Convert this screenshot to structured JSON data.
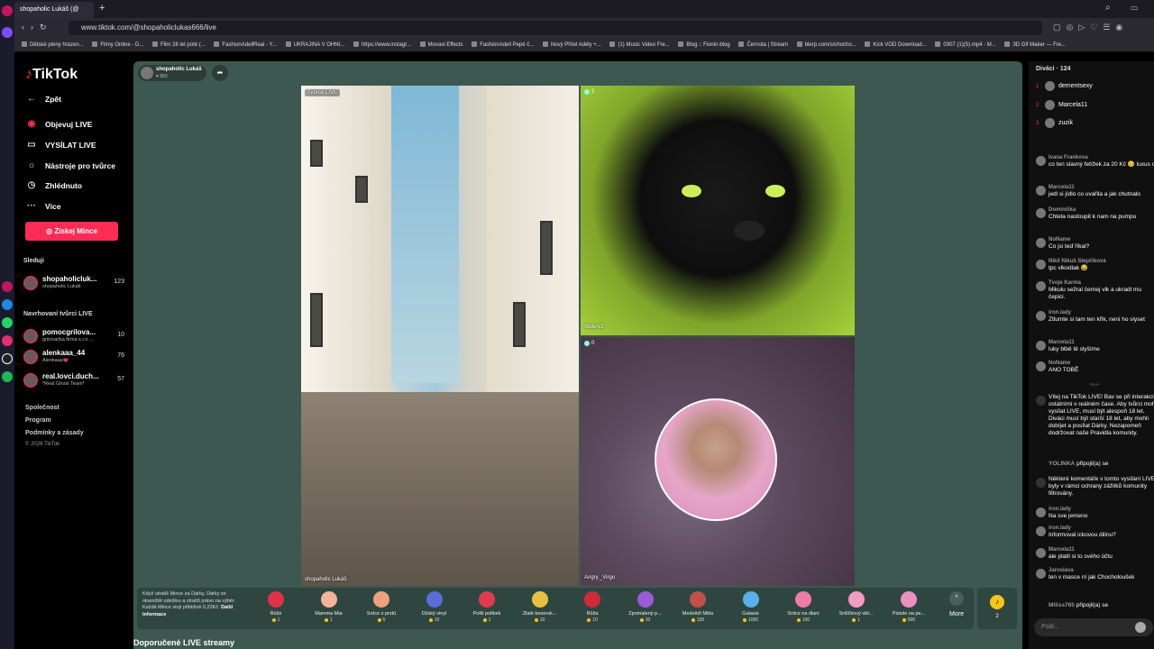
{
  "browser": {
    "tab_title": "shopaholic Lukáš (@",
    "url": "www.tiktok.com/@shopaholiclukas666/live",
    "bookmarks": [
      "Dětské pleny hrazen...",
      "Filmy Online - D...",
      "Film 28 let poté (...",
      "FashionAdellReal - Y...",
      "UKRAJINA V OHNI...",
      "https://www.instagr...",
      "Movavi Effects",
      "FashionAdell Pepé č...",
      "Nový Přítel Adély +...",
      "(1) Music Video Fre...",
      "Blog :: Fionin-blog",
      "Černota | Stream",
      "blerp.com/s/chocho...",
      "Kick VOD Download...",
      "0307 (1)(5).mp4 - M...",
      "3D Gif Maker — Fre..."
    ]
  },
  "sidebar": {
    "logo": "TikTok",
    "back": "Zpět",
    "nav": [
      "Objevuj LIVE",
      "VYSÍLAT LIVE",
      "Nástroje pro tvůrce",
      "Zhlédnuto",
      "Více"
    ],
    "coins_button": "Získej Mince",
    "following_title": "Sleduji",
    "following": [
      {
        "name": "shopaholicluk...",
        "sub": "shopaholic Lukáš",
        "count": "123"
      }
    ],
    "suggested_title": "Navrhovaní tvůrci LIVE",
    "suggested": [
      {
        "name": "pomocgrilova...",
        "sub": "grilovačka firma s.r.o ...",
        "count": "10"
      },
      {
        "name": "alenkaaa_44",
        "sub": "Alenkaaa💗",
        "count": "76"
      },
      {
        "name": "real.lovci.duch...",
        "sub": "*Real Ghost Team*",
        "count": "57"
      }
    ],
    "footer": [
      "Společnost",
      "Program",
      "Podmínky a zásady"
    ],
    "copyright": "© 2026 TikTok"
  },
  "stage": {
    "host_name": "shopaholic Lukáš",
    "host_viewers": "883",
    "main_badge": "Tvůrce LIVE",
    "main_label": "shopaholic Lukáš",
    "tr_count": "2",
    "tr_label": "Sliderv2",
    "br_count": "0",
    "br_label": "Angry._Virgo",
    "gift_info": "Když utratíš Mince za Dárky, Dárky se okamžitě odešlou a ztratíš právo na výběr. Každá Mince stojí přibližně 0,22Kč.",
    "gift_info_link": "Další informace",
    "gifts": [
      {
        "name": "Růže",
        "price": "1",
        "color": "#e0314b"
      },
      {
        "name": "Mamma Mia",
        "price": "1",
        "color": "#f2b49a"
      },
      {
        "name": "Srdce z prstů",
        "price": "5",
        "color": "#f0a07a"
      },
      {
        "name": "Džský vinyl",
        "price": "10",
        "color": "#5a6cd8"
      },
      {
        "name": "Pošli polibek",
        "price": "1",
        "color": "#e23a4a"
      },
      {
        "name": "Zlaté boxersk...",
        "price": "10",
        "color": "#e8c040"
      },
      {
        "name": "Růža",
        "price": "10",
        "color": "#d02a3a"
      },
      {
        "name": "Zpomalený p...",
        "price": "10",
        "color": "#9a5bd8"
      },
      {
        "name": "Medvědí Miša",
        "price": "100",
        "color": "#c0504a"
      },
      {
        "name": "Galaxie",
        "price": "1000",
        "color": "#5ab0e8"
      },
      {
        "name": "Srdce na dlani",
        "price": "100",
        "color": "#f07aa8"
      },
      {
        "name": "Srdíčkový obl...",
        "price": "1",
        "color": "#f59ac0"
      },
      {
        "name": "Pistole na pe...",
        "price": "500",
        "color": "#e890c0"
      }
    ],
    "more_label": "More",
    "coins_label": "2",
    "recommended": "Doporučené LIVE streamy"
  },
  "chat": {
    "viewers_title": "Diváci · 124",
    "top_viewers": [
      {
        "rank": "1",
        "name": "dementsexy"
      },
      {
        "rank": "2",
        "name": "Marcela11"
      },
      {
        "rank": "3",
        "name": "zuzik"
      }
    ],
    "messages": [
      {
        "user": "Ivana Frankova",
        "text": "co ten slavný fetížek za 20 Kč 😊 luxus co"
      },
      {
        "user": "Marcela11",
        "text": "jedl si jídlo co uvařila a jak chutnalo"
      },
      {
        "user": "Dominička",
        "text": "Chtela nastoupit k nam na pumpu"
      },
      {
        "user": "NoName",
        "text": "Co jsi teď říkal?"
      },
      {
        "user": "Nikil Nikuš Slepčíková",
        "text": "tpc vlkodlak 😂"
      },
      {
        "user": "Tvoje Karma",
        "text": "Mikulu sežral černej vlk a ukradl mu čepici."
      },
      {
        "user": "iron.lady",
        "text": "Ztlumte si tam ten křik, neni ho slyset"
      },
      {
        "user": "Marcela11",
        "text": "luky blbě tě slyšíme"
      },
      {
        "user": "NoName",
        "text": "ANO TOBĚ"
      }
    ],
    "divider": "Nové",
    "system_message": "Vítej na TikTok LIVE! Bav se při interakci s ostatními v reálném čase. Aby tvůrci mohli vysílat LIVE, musí být alespoň 18 let. Diváci musí být starší 18 let, aby mohli dobíjet a posílat Dárky. Nezapomeň dodržovat naše Pravidla komunity.",
    "join1_user": "YOLINKA",
    "join1_text": "připojil(a) se",
    "filter_message": "Některé komentáře v tomto vysílání LIVE byly v rámci ochrany zážitků komunity filtrovány.",
    "messages2": [
      {
        "user": "iron.lady",
        "text": "Na sve jemeno"
      },
      {
        "user": "iron.lady",
        "text": "Informoval ickovou dilinu?"
      },
      {
        "user": "Marcela11",
        "text": "ale platil si to svého účtu"
      },
      {
        "user": "Jaroslava",
        "text": "ten v masce ní jak Chocholoušek"
      }
    ],
    "join2_user": "Miliss765",
    "join2_text": "připojil(a) se",
    "input_placeholder": "Psát..."
  }
}
